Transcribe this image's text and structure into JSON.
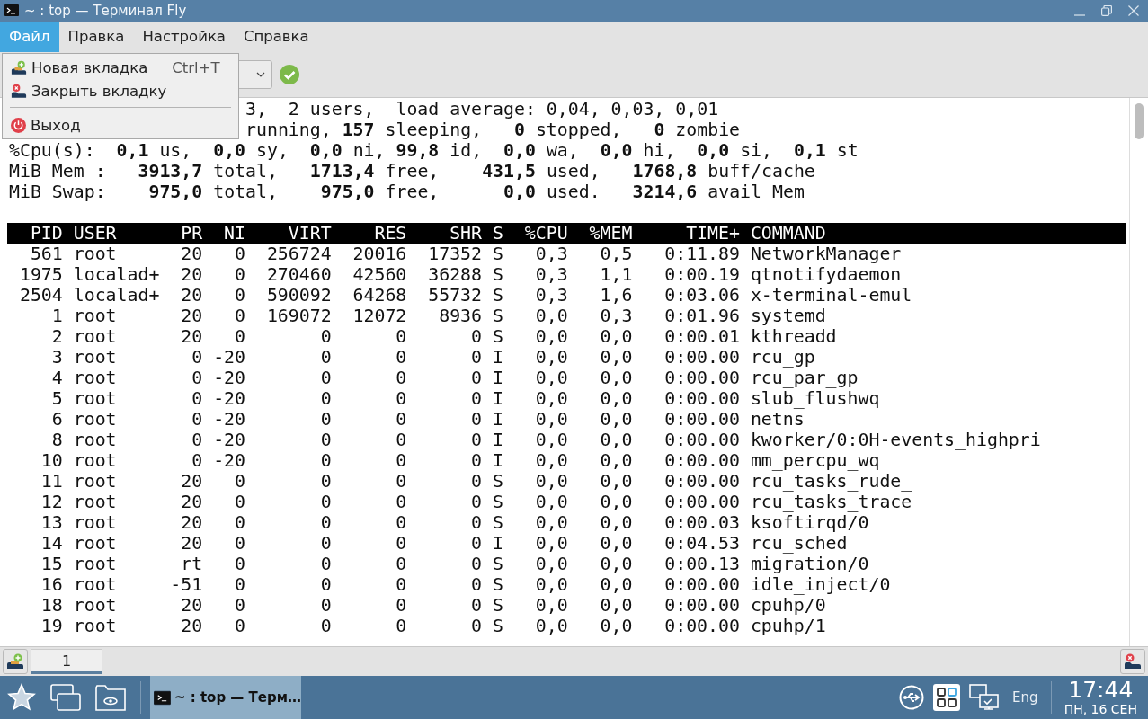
{
  "window": {
    "title": "~ : top — Терминал Fly"
  },
  "menubar": [
    {
      "label": "Файл",
      "selected": true
    },
    {
      "label": "Правка",
      "selected": false
    },
    {
      "label": "Настройка",
      "selected": false
    },
    {
      "label": "Справка",
      "selected": false
    }
  ],
  "file_menu": [
    {
      "kind": "new",
      "label": "Новая вкладка",
      "shortcut": "Ctrl+T"
    },
    {
      "kind": "close",
      "label": "Закрыть вкладку"
    },
    {
      "kind": "separator"
    },
    {
      "kind": "exit",
      "label": "Выход"
    }
  ],
  "terminal": {
    "summary_lines": [
      "3,  2 users,  load average: 0,04, 0,03, 0,01",
      "running, **157** sleeping,   **0** stopped,   **0** zombie",
      "%Cpu(s):  **0,1** us,  **0,0** sy,  **0,0** ni, **99,8** id,  **0,0** wa,  **0,0** hi,  **0,0** si,  **0,1** st",
      "MiB Mem :   **3913,7** total,   **1713,4** free,    **431,5** used,   **1768,8** buff/cache",
      "MiB Swap:    **975,0** total,    **975,0** free,      **0,0** used.   **3214,6** avail Mem"
    ],
    "table": {
      "columns": [
        "PID",
        "USER",
        "PR",
        "NI",
        "VIRT",
        "RES",
        "SHR",
        "S",
        "%CPU",
        "%MEM",
        "TIME+",
        "COMMAND"
      ],
      "rows": [
        [
          "561",
          "root",
          "20",
          "0",
          "256724",
          "20016",
          "17352",
          "S",
          "0,3",
          "0,5",
          "0:11.89",
          "NetworkManager"
        ],
        [
          "1975",
          "localad+",
          "20",
          "0",
          "270460",
          "42560",
          "36288",
          "S",
          "0,3",
          "1,1",
          "0:00.19",
          "qtnotifydaemon"
        ],
        [
          "2504",
          "localad+",
          "20",
          "0",
          "590092",
          "64268",
          "55732",
          "S",
          "0,3",
          "1,6",
          "0:03.06",
          "x-terminal-emul"
        ],
        [
          "1",
          "root",
          "20",
          "0",
          "169072",
          "12072",
          "8936",
          "S",
          "0,0",
          "0,3",
          "0:01.96",
          "systemd"
        ],
        [
          "2",
          "root",
          "20",
          "0",
          "0",
          "0",
          "0",
          "S",
          "0,0",
          "0,0",
          "0:00.01",
          "kthreadd"
        ],
        [
          "3",
          "root",
          "0",
          "-20",
          "0",
          "0",
          "0",
          "I",
          "0,0",
          "0,0",
          "0:00.00",
          "rcu_gp"
        ],
        [
          "4",
          "root",
          "0",
          "-20",
          "0",
          "0",
          "0",
          "I",
          "0,0",
          "0,0",
          "0:00.00",
          "rcu_par_gp"
        ],
        [
          "5",
          "root",
          "0",
          "-20",
          "0",
          "0",
          "0",
          "I",
          "0,0",
          "0,0",
          "0:00.00",
          "slub_flushwq"
        ],
        [
          "6",
          "root",
          "0",
          "-20",
          "0",
          "0",
          "0",
          "I",
          "0,0",
          "0,0",
          "0:00.00",
          "netns"
        ],
        [
          "8",
          "root",
          "0",
          "-20",
          "0",
          "0",
          "0",
          "I",
          "0,0",
          "0,0",
          "0:00.00",
          "kworker/0:0H-events_highpri"
        ],
        [
          "10",
          "root",
          "0",
          "-20",
          "0",
          "0",
          "0",
          "I",
          "0,0",
          "0,0",
          "0:00.00",
          "mm_percpu_wq"
        ],
        [
          "11",
          "root",
          "20",
          "0",
          "0",
          "0",
          "0",
          "S",
          "0,0",
          "0,0",
          "0:00.00",
          "rcu_tasks_rude_"
        ],
        [
          "12",
          "root",
          "20",
          "0",
          "0",
          "0",
          "0",
          "S",
          "0,0",
          "0,0",
          "0:00.00",
          "rcu_tasks_trace"
        ],
        [
          "13",
          "root",
          "20",
          "0",
          "0",
          "0",
          "0",
          "S",
          "0,0",
          "0,0",
          "0:00.03",
          "ksoftirqd/0"
        ],
        [
          "14",
          "root",
          "20",
          "0",
          "0",
          "0",
          "0",
          "I",
          "0,0",
          "0,0",
          "0:04.53",
          "rcu_sched"
        ],
        [
          "15",
          "root",
          "rt",
          "0",
          "0",
          "0",
          "0",
          "S",
          "0,0",
          "0,0",
          "0:00.13",
          "migration/0"
        ],
        [
          "16",
          "root",
          "-51",
          "0",
          "0",
          "0",
          "0",
          "S",
          "0,0",
          "0,0",
          "0:00.00",
          "idle_inject/0"
        ],
        [
          "18",
          "root",
          "20",
          "0",
          "0",
          "0",
          "0",
          "S",
          "0,0",
          "0,0",
          "0:00.00",
          "cpuhp/0"
        ],
        [
          "19",
          "root",
          "20",
          "0",
          "0",
          "0",
          "0",
          "S",
          "0,0",
          "0,0",
          "0:00.00",
          "cpuhp/1"
        ]
      ]
    }
  },
  "tabs": [
    {
      "label": "1",
      "selected": true
    }
  ],
  "taskbar": {
    "tasks": [
      {
        "label": "~ : top — Терм…",
        "selected": true
      }
    ],
    "language": "Eng",
    "time": "17:44",
    "date": "ПН, 16 СЕН"
  }
}
